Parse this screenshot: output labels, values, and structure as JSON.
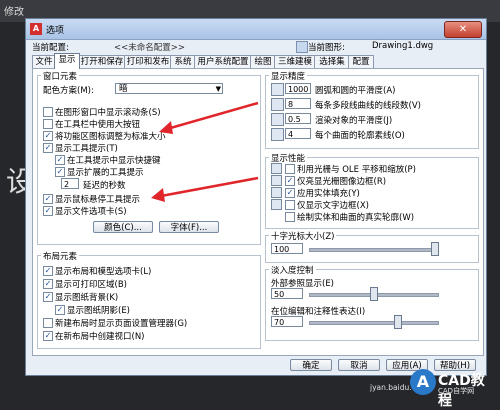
{
  "background": {
    "left_text": "修改",
    "left_glyph": "设"
  },
  "dialog": {
    "title": "选项",
    "close_label": "✕",
    "current_profile_label": "当前配置:",
    "current_profile_value": "<<未命名配置>>",
    "current_drawing_label": "当前图形:",
    "current_drawing_value": "Drawing1.dwg"
  },
  "tabs": [
    "文件",
    "显示",
    "打开和保存",
    "打印和发布",
    "系统",
    "用户系统配置",
    "绘图",
    "三维建模",
    "选择集",
    "配置"
  ],
  "window_elements": {
    "title": "窗口元素",
    "color_scheme_label": "配色方案(M):",
    "color_scheme_value": "暗",
    "options": [
      {
        "label": "在图形窗口中显示滚动条(S)",
        "checked": false
      },
      {
        "label": "在工具栏中使用大按钮",
        "checked": false
      },
      {
        "label": "将功能区图标调整为标准大小",
        "checked": true
      },
      {
        "label": "显示工具提示(T)",
        "checked": true
      },
      {
        "label": "在工具提示中显示快捷键",
        "checked": true
      },
      {
        "label": "显示扩展的工具提示",
        "checked": true
      },
      {
        "label": "显示鼠标悬停工具提示",
        "checked": true
      },
      {
        "label": "显示文件选项卡(S)",
        "checked": true
      }
    ],
    "delay_value": "2",
    "delay_label": "延迟的秒数",
    "colors_button": "颜色(C)...",
    "fonts_button": "字体(F)..."
  },
  "layout_elements": {
    "title": "布局元素",
    "options": [
      {
        "label": "显示布局和模型选项卡(L)",
        "checked": true
      },
      {
        "label": "显示可打印区域(B)",
        "checked": true
      },
      {
        "label": "显示图纸背景(K)",
        "checked": true
      },
      {
        "label": "显示图纸阴影(E)",
        "checked": true
      },
      {
        "label": "新建布局时显示页面设置管理器(G)",
        "checked": false
      },
      {
        "label": "在新布局中创建视口(N)",
        "checked": true
      }
    ]
  },
  "display_resolution": {
    "title": "显示精度",
    "items": [
      {
        "value": "1000",
        "label": "圆弧和圆的平滑度(A)"
      },
      {
        "value": "8",
        "label": "每条多段线曲线的线段数(V)"
      },
      {
        "value": "0.5",
        "label": "渲染对象的平滑度(J)"
      },
      {
        "value": "4",
        "label": "每个曲面的轮廓素线(O)"
      }
    ]
  },
  "display_performance": {
    "title": "显示性能",
    "options": [
      {
        "label": "利用光栅与 OLE 平移和缩放(P)",
        "checked": false
      },
      {
        "label": "仅亮显光栅图像边框(R)",
        "checked": true
      },
      {
        "label": "应用实体填充(Y)",
        "checked": true
      },
      {
        "label": "仅显示文字边框(X)",
        "checked": false
      },
      {
        "label": "绘制实体和曲面的真实轮廓(W)",
        "checked": false
      }
    ]
  },
  "crosshair": {
    "title": "十字光标大小(Z)",
    "value": "100",
    "level": 1.0
  },
  "fade_control": {
    "title": "淡入度控制",
    "xref_label": "外部参照显示(E)",
    "xref_value": "50",
    "xref_level": 0.5,
    "inplace_label": "在位编辑和注释性表达(I)",
    "inplace_value": "70",
    "inplace_level": 0.7
  },
  "footer": {
    "ok": "确定",
    "cancel": "取消",
    "apply": "应用(A)",
    "help": "帮助(H)"
  },
  "watermark": {
    "badge": "A",
    "brand": "CAD教程",
    "sub": "CAD自学网",
    "url": "jyan.baidu.com"
  }
}
